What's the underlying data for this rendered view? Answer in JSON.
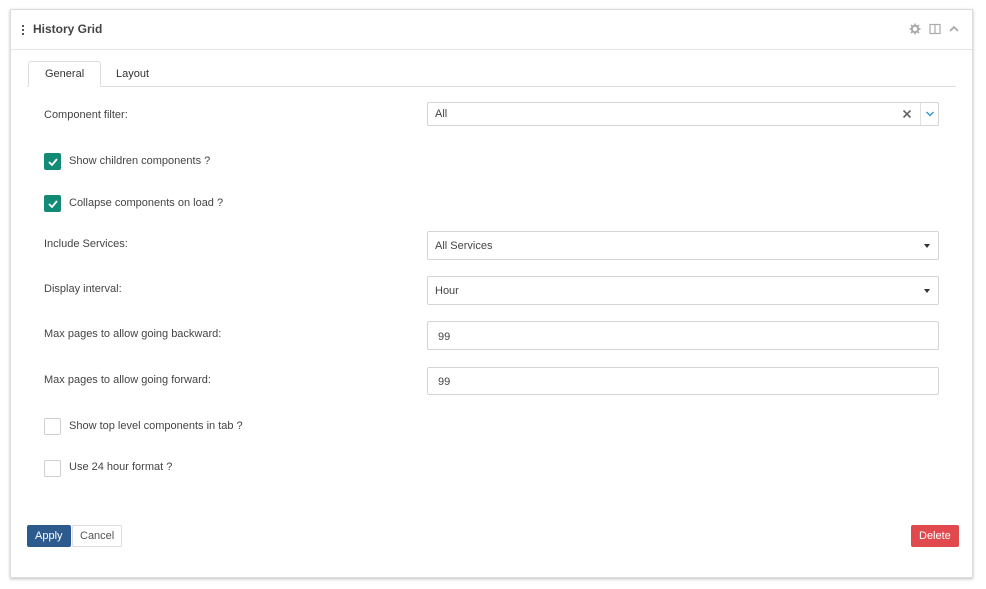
{
  "panel": {
    "title": "History Grid",
    "header_icons": [
      "gear-icon",
      "columns-icon",
      "chevron-up-icon"
    ]
  },
  "tabs": [
    {
      "label": "General",
      "active": true
    },
    {
      "label": "Layout",
      "active": false
    }
  ],
  "form": {
    "component_filter": {
      "label": "Component filter:",
      "value": "All"
    },
    "show_children": {
      "label": "Show children components ?",
      "checked": true
    },
    "collapse_on_load": {
      "label": "Collapse components on load ?",
      "checked": true
    },
    "include_services": {
      "label": "Include Services:",
      "value": "All Services"
    },
    "display_interval": {
      "label": "Display interval:",
      "value": "Hour"
    },
    "max_backward": {
      "label": "Max pages to allow going backward:",
      "value": "99"
    },
    "max_forward": {
      "label": "Max pages to allow going forward:",
      "value": "99"
    },
    "show_top_level": {
      "label": "Show top level components in tab ?",
      "checked": false
    },
    "use_24h": {
      "label": "Use 24 hour format ?",
      "checked": false
    }
  },
  "buttons": {
    "apply": "Apply",
    "cancel": "Cancel",
    "delete": "Delete"
  },
  "colors": {
    "accent_checked": "#138a76",
    "apply": "#2d5b8e",
    "delete": "#e0494d"
  }
}
